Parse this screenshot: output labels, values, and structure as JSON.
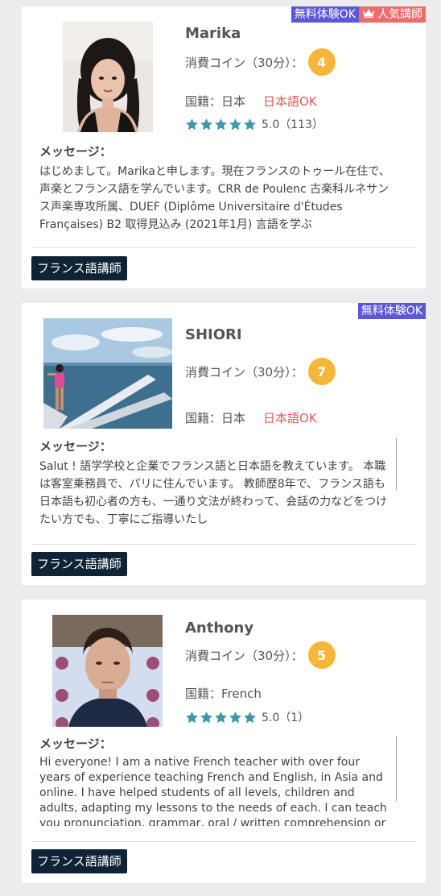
{
  "labels": {
    "coin_label": "消費コイン（30分）：",
    "nationality_prefix": "国籍：",
    "message_label": "メッセージ："
  },
  "badges": {
    "trial": "無料体験OK",
    "popular": "人気講師"
  },
  "colors": {
    "coin": "#f5b63a",
    "star": "#3f97a8",
    "trial_badge": "#5b57d6",
    "popular_badge": "#ee6c6c",
    "jp_ok": "#e45a5a",
    "tag_bg": "#0f2336"
  },
  "teachers": [
    {
      "name": "Marika",
      "coins": "4",
      "nationality": "日本",
      "jp_ok": "日本語OK",
      "rating": "5.0（113）",
      "stars": 5,
      "message": "はじめまして。Marikaと申します。現在フランスのトゥール在住で、声楽とフランス語を学んでいます。CRR de Poulenc 古楽科ルネサンス声楽専攻所属、DUEF (Diplôme Universitaire d'Études Françaises) B2 取得見込み (2021年1月) 言語を学ぶ",
      "tag": "フランス語講師"
    },
    {
      "name": "SHIORI",
      "coins": "7",
      "nationality": "日本",
      "jp_ok": "日本語OK",
      "message": "Salut ! 語学学校と企業でフランス語と日本語を教えています。 本職は客室乗務員で、パリに住んでいます。 教師歴8年で、フランス語も日本語も初心者の方も、一通り文法が終わって、会話の力などをつけたい方でも、丁寧にご指導いたし",
      "tag": "フランス語講師"
    },
    {
      "name": "Anthony",
      "coins": "5",
      "nationality": "French",
      "rating": "5.0（1）",
      "stars": 5,
      "message": "Hi everyone! I am a native French teacher with over four years of experience teaching French and English, in Asia and online. I have helped students of all levels, children and adults, adapting my lessons to the needs of each. I can teach you pronunciation, grammar, oral / written comprehension or",
      "tag": "フランス語講師"
    }
  ]
}
